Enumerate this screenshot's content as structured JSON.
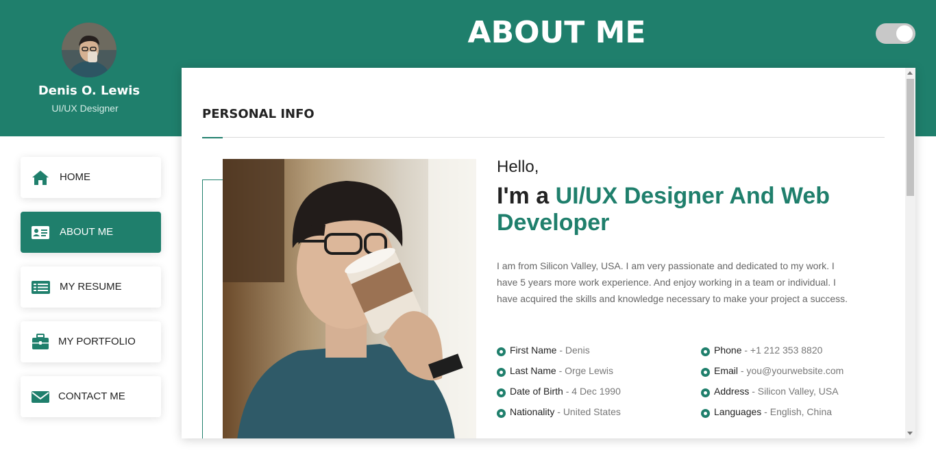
{
  "profile": {
    "name": "Denis O. Lewis",
    "role": "UI/UX Designer"
  },
  "header": {
    "title": "ABOUT ME"
  },
  "theme_toggle": {
    "state": "on"
  },
  "nav": {
    "items": [
      {
        "label": "HOME",
        "icon": "home-icon",
        "active": false
      },
      {
        "label": "ABOUT ME",
        "icon": "id-card-icon",
        "active": true
      },
      {
        "label": "MY RESUME",
        "icon": "list-icon",
        "active": false
      },
      {
        "label": "MY PORTFOLIO",
        "icon": "briefcase-icon",
        "active": false
      },
      {
        "label": "CONTACT ME",
        "icon": "envelope-icon",
        "active": false
      }
    ]
  },
  "section": {
    "title": "PERSONAL INFO"
  },
  "about": {
    "hello": "Hello,",
    "intro_prefix": "I'm a ",
    "intro_accent": "UI/UX Designer And Web Developer",
    "bio": "I am from Silicon Valley, USA. I am very passionate and dedicated to my work. I have 5 years more work experience. And enjoy working in a team or individual. I have acquired the skills and knowledge necessary to make your project a success."
  },
  "info": {
    "left": [
      {
        "label": "First Name",
        "value": " - Denis"
      },
      {
        "label": "Last Name",
        "value": " - Orge Lewis"
      },
      {
        "label": "Date of Birth",
        "value": " - 4 Dec 1990"
      },
      {
        "label": "Nationality",
        "value": " - United States"
      }
    ],
    "right": [
      {
        "label": "Phone",
        "value": " - +1 212 353 8820"
      },
      {
        "label": "Email",
        "value": " - you@yourwebsite.com"
      },
      {
        "label": "Address",
        "value": " - Silicon Valley, USA"
      },
      {
        "label": "Languages",
        "value": " - English, China"
      }
    ]
  },
  "colors": {
    "accent": "#1f7f6c",
    "text": "#222222",
    "muted": "#777777"
  }
}
